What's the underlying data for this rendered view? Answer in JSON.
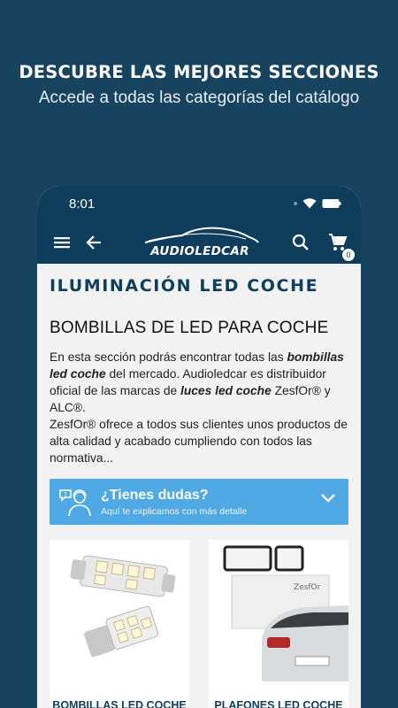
{
  "promo": {
    "title": "DESCUBRE LAS MEJORES SECCIONES",
    "subtitle": "Accede a todas las categorías del catálogo"
  },
  "status_bar": {
    "time": "8:01"
  },
  "app_bar": {
    "logo_text": "AUDIOLEDCAR",
    "cart_count": "0"
  },
  "page": {
    "section_title": "ILUMINACIÓN LED COCHE",
    "subheading": "BOMBILLAS DE LED PARA COCHE",
    "description": {
      "p1_a": "En esta sección podrás encontrar todas las ",
      "p1_b": "bombillas led coche",
      "p1_c": " del mercado. Audioledcar es distribuidor oficial de las marcas de ",
      "p1_d": "luces led coche",
      "p1_e": " ZesfOr® y ALC®.",
      "p2": "ZesfOr® ofrece a todos sus clientes unos productos de alta calidad y acabado cumpliendo con todos las normativa..."
    }
  },
  "faq": {
    "title": "¿Tienes dudas?",
    "subtitle": "Aquí te explicamos con más detalle"
  },
  "products": [
    {
      "name": "BOMBILLAS LED COCHE"
    },
    {
      "name": "PLAFONES LED COCHE"
    }
  ],
  "colors": {
    "background": "#17435f",
    "app_bar": "#0f3d5c",
    "faq_banner": "#4fa9e4",
    "content_bg": "#f2f2f2"
  }
}
